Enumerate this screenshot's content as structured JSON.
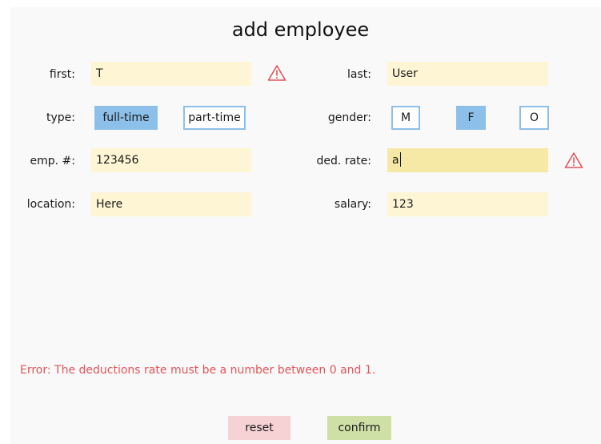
{
  "title": "add employee",
  "labels": {
    "first": "first:",
    "last": "last:",
    "type": "type:",
    "gender": "gender:",
    "emp_num": "emp. #:",
    "ded_rate": "ded. rate:",
    "location": "location:",
    "salary": "salary:"
  },
  "fields": {
    "first": "T",
    "last": "User",
    "emp_num": "123456",
    "ded_rate": "a",
    "location": "Here",
    "salary": "123"
  },
  "type_options": {
    "full_time": "full-time",
    "part_time": "part-time",
    "selected": "full-time"
  },
  "gender_options": {
    "m": "M",
    "f": "F",
    "o": "O",
    "selected": "F"
  },
  "error_message": "Error: The deductions rate must be a number between 0 and 1.",
  "buttons": {
    "reset": "reset",
    "confirm": "confirm"
  },
  "icons": {
    "warning": "warning-triangle-icon"
  },
  "colors": {
    "field_bg": "#fdf5d3",
    "field_focus_bg": "#f6e8a5",
    "toggle_selected": "#8cc0ea",
    "error_text": "#e0555a",
    "reset_bg": "#f6d2d4",
    "confirm_bg": "#cfe0a7"
  }
}
